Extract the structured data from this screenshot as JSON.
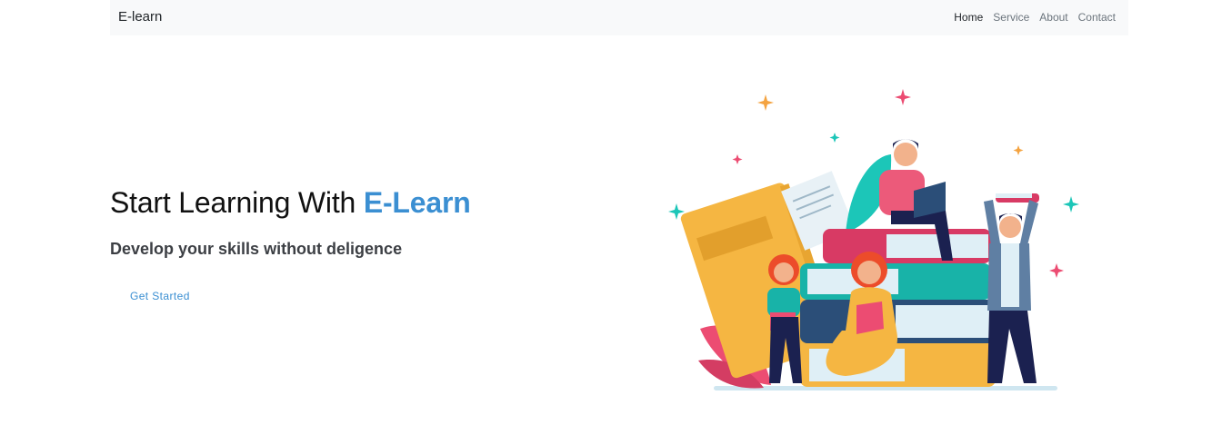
{
  "nav": {
    "brand": "E-learn",
    "links": [
      {
        "label": "Home",
        "active": true
      },
      {
        "label": "Service",
        "active": false
      },
      {
        "label": "About",
        "active": false
      },
      {
        "label": "Contact",
        "active": false
      }
    ]
  },
  "hero": {
    "title_prefix": "Start Learning With ",
    "title_accent": "E-Learn",
    "subtitle": "Develop your skills without deligence",
    "cta_label": "Get Started"
  },
  "colors": {
    "accent": "#3b8fd2",
    "navbar_bg": "#f8f9fa"
  },
  "illustration": {
    "icon": "students-reading-books-illustration"
  }
}
